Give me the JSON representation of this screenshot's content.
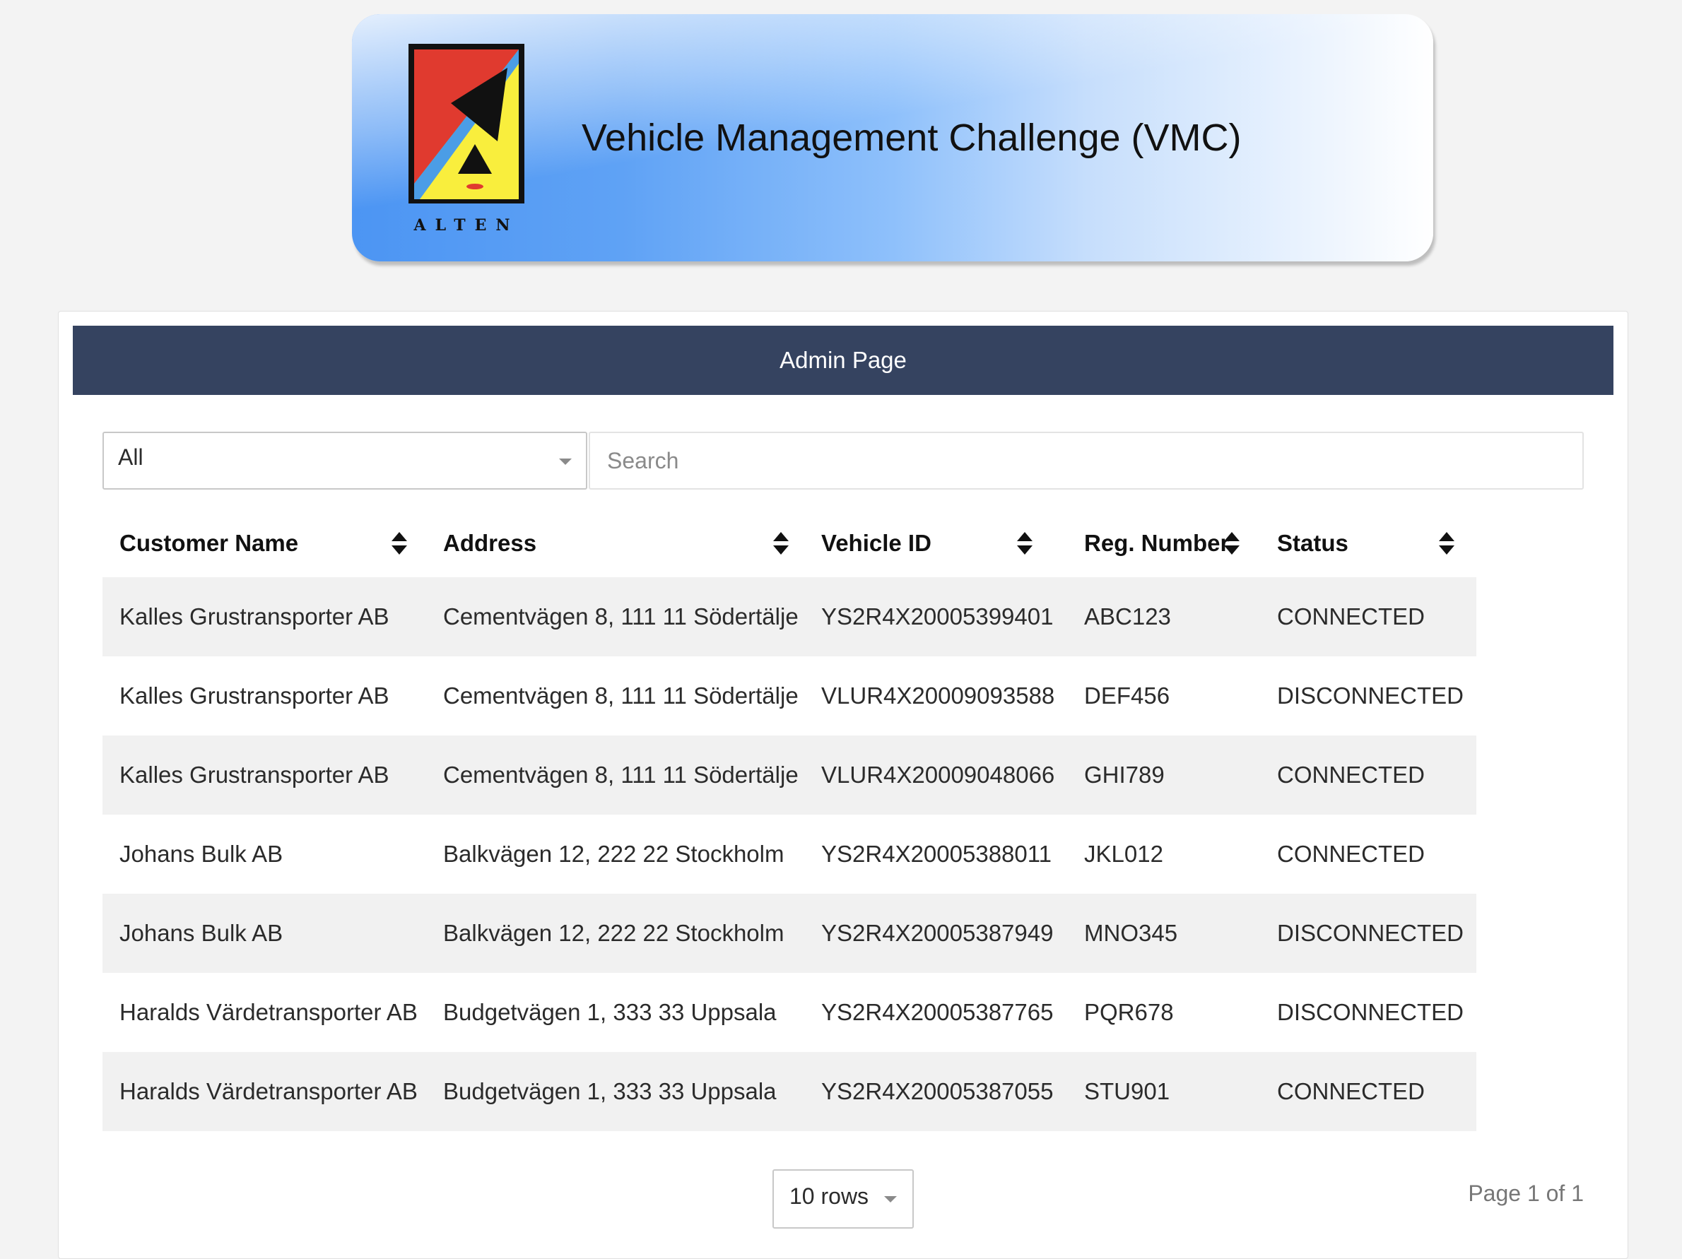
{
  "banner": {
    "title": "Vehicle Management Challenge (VMC)",
    "logo_text": "ALTEN",
    "colors": {
      "gradient_start": "#4c95f3",
      "gradient_end": "#ffffff"
    }
  },
  "header": {
    "title": "Admin Page",
    "background": "#354360"
  },
  "filter": {
    "selected": "All",
    "search_placeholder": "Search"
  },
  "table": {
    "columns": [
      "Customer Name",
      "Address",
      "Vehicle ID",
      "Reg. Number",
      "Status"
    ],
    "rows": [
      {
        "customer": "Kalles Grustransporter AB",
        "address": "Cementvägen 8, 111 11 Södertälje",
        "vehicle_id": "YS2R4X20005399401",
        "reg": "ABC123",
        "status": "CONNECTED"
      },
      {
        "customer": "Kalles Grustransporter AB",
        "address": "Cementvägen 8, 111 11 Södertälje",
        "vehicle_id": "VLUR4X20009093588",
        "reg": "DEF456",
        "status": "DISCONNECTED"
      },
      {
        "customer": "Kalles Grustransporter AB",
        "address": "Cementvägen 8, 111 11 Södertälje",
        "vehicle_id": "VLUR4X20009048066",
        "reg": "GHI789",
        "status": "CONNECTED"
      },
      {
        "customer": "Johans Bulk AB",
        "address": "Balkvägen 12, 222 22 Stockholm",
        "vehicle_id": "YS2R4X20005388011",
        "reg": "JKL012",
        "status": "CONNECTED"
      },
      {
        "customer": "Johans Bulk AB",
        "address": "Balkvägen 12, 222 22 Stockholm",
        "vehicle_id": "YS2R4X20005387949",
        "reg": "MNO345",
        "status": "DISCONNECTED"
      },
      {
        "customer": "Haralds Värdetransporter AB",
        "address": "Budgetvägen 1, 333 33 Uppsala",
        "vehicle_id": "YS2R4X20005387765",
        "reg": "PQR678",
        "status": "DISCONNECTED"
      },
      {
        "customer": "Haralds Värdetransporter AB",
        "address": "Budgetvägen 1, 333 33 Uppsala",
        "vehicle_id": "YS2R4X20005387055",
        "reg": "STU901",
        "status": "CONNECTED"
      }
    ]
  },
  "pagination": {
    "rows_label": "10 rows",
    "page_info": "Page 1 of 1"
  }
}
